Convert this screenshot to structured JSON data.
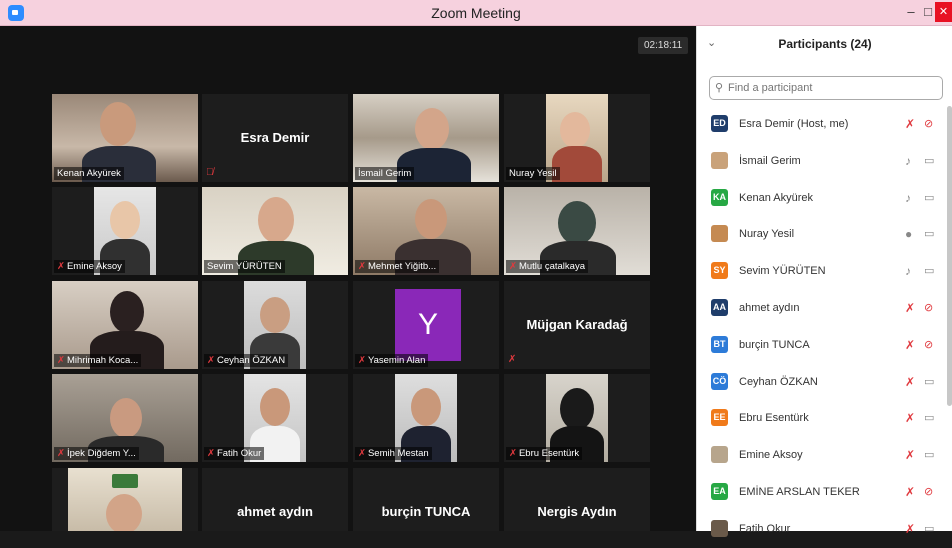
{
  "window": {
    "title": "Zoom Meeting",
    "minimize": "–",
    "maximize": "□",
    "close": "✕"
  },
  "meeting": {
    "timer": "02:18:11"
  },
  "tiles": [
    {
      "name": "Kenan Akyürek",
      "muted": false
    },
    {
      "name": "Esra Demir",
      "muted": true,
      "no_video": true
    },
    {
      "name": "İsmail Gerim",
      "muted": false
    },
    {
      "name": "Nuray Yesil",
      "muted": false
    },
    {
      "name": "Emine Aksoy",
      "muted": true
    },
    {
      "name": "Sevim YÜRÜTEN",
      "muted": false,
      "active": true
    },
    {
      "name": "Mehmet Yiğitb...",
      "muted": true
    },
    {
      "name": "Mutlu çatalkaya",
      "muted": true
    },
    {
      "name": "Mihrimah Koca...",
      "muted": true
    },
    {
      "name": "Ceyhan ÖZKAN",
      "muted": true
    },
    {
      "name": "Yasemin Alan",
      "muted": true,
      "initial": "Y"
    },
    {
      "name": "Müjgan Karadağ",
      "muted": true,
      "no_video": true
    },
    {
      "name": "İpek Diğdem Y...",
      "muted": true
    },
    {
      "name": "Fatih Okur",
      "muted": true
    },
    {
      "name": "Semih Mestan",
      "muted": true
    },
    {
      "name": "Ebru Esentürk",
      "muted": true
    },
    {
      "name": "",
      "muted": false
    },
    {
      "name": "ahmet aydın",
      "no_video": true
    },
    {
      "name": "burçin TUNCA",
      "no_video": true
    },
    {
      "name": "Nergis Aydın",
      "no_video": true
    }
  ],
  "participants_panel": {
    "title": "Participants (24)",
    "search_placeholder": "Find a participant",
    "items": [
      {
        "initials": "ED",
        "name": "Esra Demir (Host, me)",
        "color": "#1f3d6b",
        "mic": "muted",
        "video": "off"
      },
      {
        "initials": "",
        "name": "İsmail Gerim",
        "color": "#c9a27a",
        "mic": "on",
        "video": "on"
      },
      {
        "initials": "KA",
        "name": "Kenan Akyürek",
        "color": "#27a844",
        "mic": "on",
        "video": "on"
      },
      {
        "initials": "",
        "name": "Nuray Yesil",
        "color": "#c58a52",
        "mic": "active",
        "video": "on"
      },
      {
        "initials": "SY",
        "name": "Sevim YÜRÜTEN",
        "color": "#f07a1a",
        "mic": "on",
        "video": "on"
      },
      {
        "initials": "AA",
        "name": "ahmet aydın",
        "color": "#1f3d6b",
        "mic": "muted",
        "video": "off"
      },
      {
        "initials": "BT",
        "name": "burçin TUNCA",
        "color": "#2d7bd8",
        "mic": "muted",
        "video": "off"
      },
      {
        "initials": "CÖ",
        "name": "Ceyhan ÖZKAN",
        "color": "#2d7bd8",
        "mic": "muted",
        "video": "on"
      },
      {
        "initials": "EE",
        "name": "Ebru Esentürk",
        "color": "#f07a1a",
        "mic": "muted",
        "video": "on"
      },
      {
        "initials": "",
        "name": "Emine Aksoy",
        "color": "#b7a58c",
        "mic": "muted",
        "video": "on"
      },
      {
        "initials": "EA",
        "name": "EMİNE ARSLAN TEKER",
        "color": "#27a844",
        "mic": "muted",
        "video": "off"
      },
      {
        "initials": "",
        "name": "Fatih Okur",
        "color": "#6a5a4a",
        "mic": "muted",
        "video": "on"
      }
    ]
  }
}
